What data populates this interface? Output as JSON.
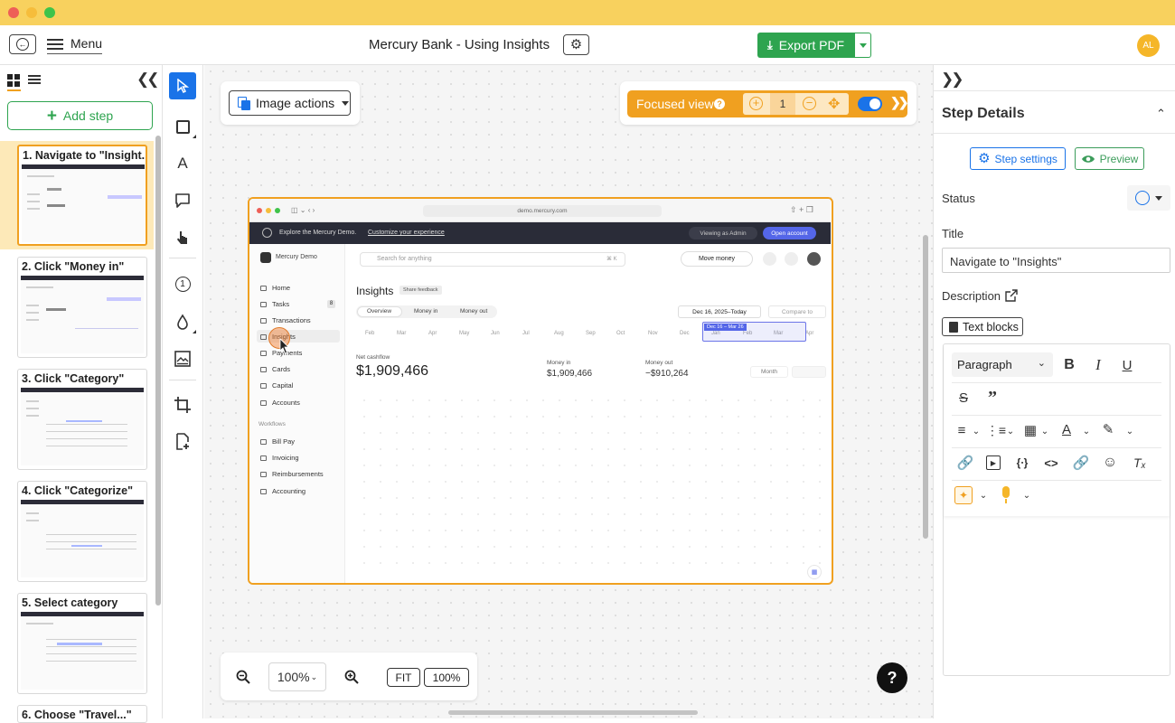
{
  "window": {
    "title": "Mercury Bank - Using Insights"
  },
  "header": {
    "menu_label": "Menu",
    "export_label": "Export PDF",
    "avatar_initials": "AL"
  },
  "left": {
    "add_step_label": "Add step",
    "steps": [
      {
        "label": "1. Navigate to \"Insight..."
      },
      {
        "label": "2. Click \"Money in\""
      },
      {
        "label": "3. Click \"Category\""
      },
      {
        "label": "4. Click \"Categorize\""
      },
      {
        "label": "5. Select category"
      },
      {
        "label": "6. Choose \"Travel...\""
      }
    ]
  },
  "canvas": {
    "image_actions_label": "Image actions",
    "focused_view_label": "Focused view",
    "focus_zoom_value": "1",
    "zoom_value": "100%",
    "fit_label": "FIT",
    "hundred_label": "100%",
    "help_label": "?"
  },
  "screenshot": {
    "url": "demo.mercury.com",
    "banner_text": "Explore the Mercury Demo.",
    "banner_link": "Customize your experience",
    "viewing_as": "Viewing as Admin",
    "open_account": "Open account",
    "org_name": "Mercury Demo",
    "search_placeholder": "Search for anything",
    "search_shortcut": "⌘ K",
    "move_money": "Move money",
    "nav": [
      "Home",
      "Tasks",
      "Transactions",
      "Insights",
      "Payments",
      "Cards",
      "Capital",
      "Accounts"
    ],
    "tasks_badge": "8",
    "workflows_label": "Workflows",
    "workflow_nav": [
      "Bill Pay",
      "Invoicing",
      "Reimbursements",
      "Accounting"
    ],
    "page_title": "Insights",
    "share_feedback": "Share feedback",
    "tabs": [
      "Overview",
      "Money in",
      "Money out"
    ],
    "date_range": "Dec 16, 2025–Today",
    "compare_to": "Compare to",
    "months": [
      "Feb",
      "Mar",
      "Apr",
      "May",
      "Jun",
      "Jul",
      "Aug",
      "Sep",
      "Oct",
      "Nov",
      "Dec",
      "Jan",
      "Feb",
      "Mar",
      "Apr"
    ],
    "range_badge": "Dec 16 – Mar 26",
    "net_cashflow_label": "Net cashflow",
    "net_cashflow_value": "$1,909,466",
    "money_in_label": "Money in",
    "money_in_value": "$1,909,466",
    "money_out_label": "Money out",
    "money_out_value": "−$910,264",
    "interval": "Month"
  },
  "right": {
    "section_title": "Step Details",
    "step_settings_label": "Step settings",
    "preview_label": "Preview",
    "status_label": "Status",
    "title_label": "Title",
    "title_value": "Navigate to \"Insights\"",
    "description_label": "Description",
    "text_blocks_label": "Text blocks",
    "paragraph_label": "Paragraph"
  },
  "colors": {
    "titlebar": "#f8d15e",
    "accent_orange": "#f0a020",
    "export_green": "#2ea44f",
    "primary_blue": "#1a73e8",
    "preview_green": "#3b9c5a"
  }
}
